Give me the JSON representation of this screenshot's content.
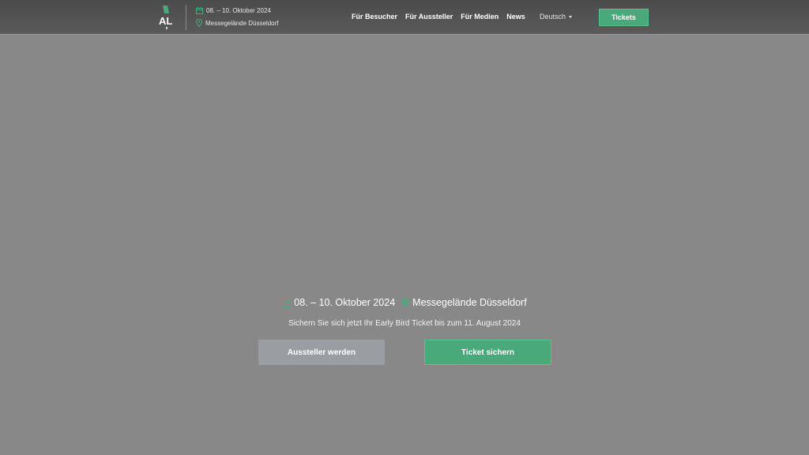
{
  "brand": {
    "logo_text": "AL",
    "accent": "#4aa97a"
  },
  "header": {
    "date": "08. – 10. Oktober 2024",
    "location": "Messegelände Düsseldorf",
    "nav": [
      {
        "label": "Für Besucher"
      },
      {
        "label": "Für Aussteller"
      },
      {
        "label": "Für Medien"
      },
      {
        "label": "News"
      }
    ],
    "language": "Deutsch",
    "tickets_label": "Tickets"
  },
  "hero": {
    "date": "08. – 10. Oktober 2024",
    "location": "Messegelände Düsseldorf",
    "early_bird": "Sichern Sie sich jetzt Ihr Early Bird Ticket bis zum 11. August 2024",
    "exhibitor_button": "Aussteller werden",
    "ticket_button": "Ticket sichern"
  },
  "icons": {
    "calendar": "calendar-icon",
    "location": "location-pin-icon",
    "language": "chevron-down-icon"
  }
}
